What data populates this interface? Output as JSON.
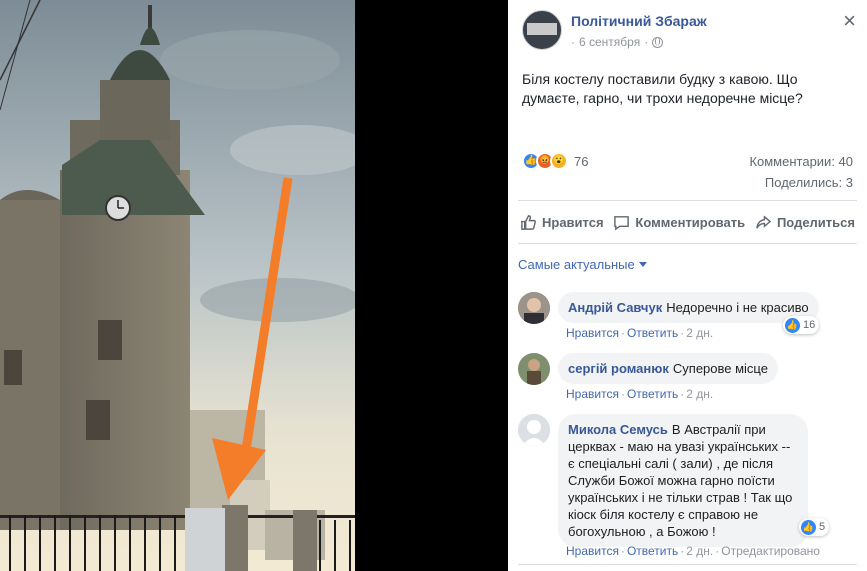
{
  "post": {
    "page_name": "Політичний Збараж",
    "date": "6 сентября",
    "separator": "·",
    "close_glyph": "×",
    "text": "Біля костелу поставили будку з кавою. Що думаєте, гарно, чи трохи недоречне місце?",
    "reactions": {
      "icons": [
        "like-icon",
        "angry-icon",
        "wow-icon"
      ],
      "count": "76"
    },
    "comments_count": "Комментарии: 40",
    "shares_count": "Поделились: 3"
  },
  "actions": {
    "like": "Нравится",
    "comment": "Комментировать",
    "share": "Поделиться"
  },
  "sort_label": "Самые актуальные",
  "comments": [
    {
      "author": "Андрій Савчук",
      "text": "Недоречно і не красиво",
      "like": "Нравится",
      "reply": "Ответить",
      "time": "2 дн.",
      "reactions": "16"
    },
    {
      "author": "сергій романюк",
      "text": "Суперове місце",
      "like": "Нравится",
      "reply": "Ответить",
      "time": "2 дн."
    },
    {
      "author": "Микола Семусь",
      "text": "В Австралії при церквах - маю на увазі українських -- є спеціальні салі ( зали) , де після Служби Божої можна гарно поїсти українських і не тільки страв ! Так що кіоск біля костелу є справою не богохульною , а Божою !",
      "like": "Нравится",
      "reply": "Ответить",
      "time": "2 дн.",
      "edited": "Отредактировано",
      "reactions": "5"
    }
  ],
  "colors": {
    "link_blue": "#385898",
    "action_blue": "#4267b2",
    "arrow_orange": "#f47d2a"
  }
}
